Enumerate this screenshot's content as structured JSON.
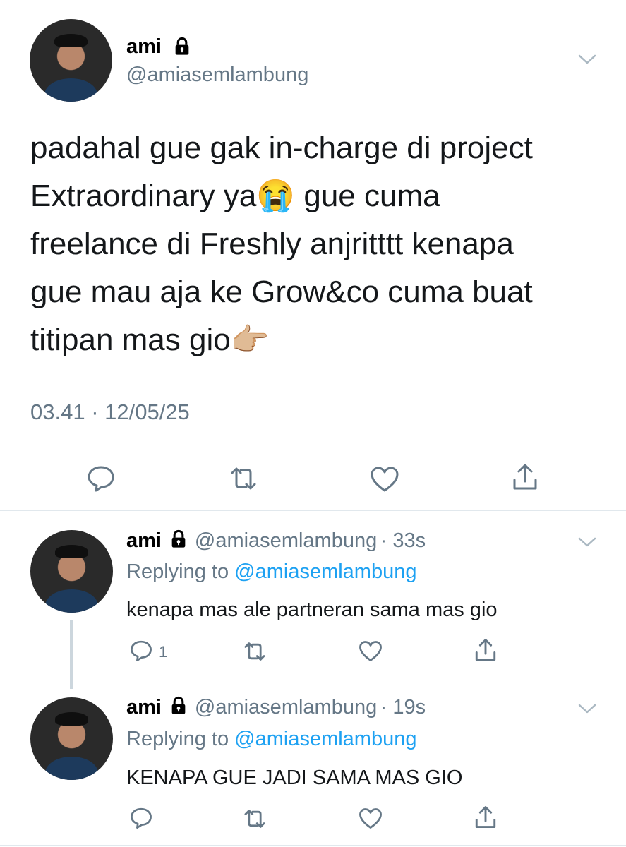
{
  "main_tweet": {
    "author_name": "ami",
    "lock_icon": "lock-icon",
    "handle": "@amiasemlambung",
    "text_lines": [
      "padahal gue gak in-charge di project",
      "Extraordinary ya😭 gue cuma",
      "freelance di Freshly anjritttt kenapa",
      "gue mau aja ke Grow&co cuma buat",
      "titipan mas gio👉🏼"
    ],
    "timestamp": "03.41 · 12/05/25",
    "actions": [
      "reply-icon",
      "retweet-icon",
      "like-icon",
      "share-icon"
    ]
  },
  "replies": [
    {
      "author_name": "ami",
      "handle": "@amiasemlambung",
      "time": "· 33s",
      "replying_prefix": "Replying to ",
      "replying_handle": "@amiasemlambung",
      "text": "kenapa mas ale partneran sama mas gio",
      "reply_count": "1"
    },
    {
      "author_name": "ami",
      "handle": "@amiasemlambung",
      "time": "· 19s",
      "replying_prefix": "Replying to ",
      "replying_handle": "@amiasemlambung",
      "text": "KENAPA GUE JADI SAMA MAS GIO",
      "reply_count": ""
    }
  ],
  "colors": {
    "accent": "#1da1f2",
    "secondary_text": "#657786",
    "divider": "#e1e8ed",
    "icon": "#657786"
  }
}
